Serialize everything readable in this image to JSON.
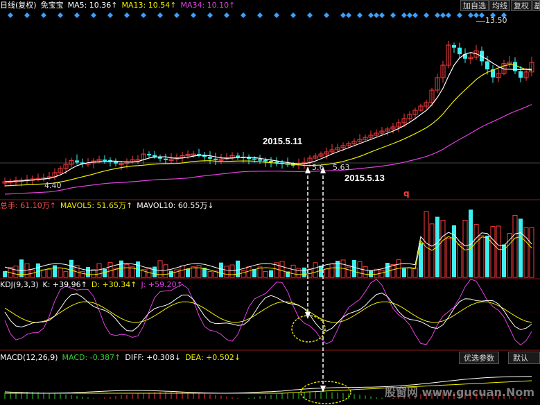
{
  "header": {
    "period": "日线(复权)",
    "stock": "免宝宝",
    "ma5": "MA5: 10.36↑",
    "ma13": "MA13: 10.54↑",
    "ma34": "MA34: 10.10↑",
    "buttons": [
      "加自选",
      "均线",
      "复权",
      "基"
    ]
  },
  "volume_header": {
    "total": "总手: 61.10万↑",
    "mavol5": "MAVOL5: 51.65万↑",
    "mavol10": "MAVOL10: 60.55万↓"
  },
  "kdj_header": {
    "name": "KDJ(9,3,3)",
    "k": "K: +39.96↑",
    "d": "D: +30.34↑",
    "j": "J: +59.20↑"
  },
  "macd_header": {
    "name": "MACD(12,26,9)",
    "macd": "MACD: -0.387↑",
    "diff": "DIFF: +0.308↓",
    "dea": "DEA: +0.502↓",
    "buttons": [
      "优选参数",
      "默认参"
    ]
  },
  "annotations": {
    "date1": "2015.5.11",
    "date2": "2015.5.13",
    "high_label": "13.50",
    "low_label": "4.40",
    "low2_label": "5.63",
    "low3_label": "5.6",
    "q": "q"
  },
  "watermark": "股窗网 www.gucuan.Nom",
  "colors": {
    "up": "#ff3c3c",
    "down": "#3cf0f0",
    "ma5": "#ffffff",
    "ma13": "#f0f000",
    "ma34": "#e040e0",
    "diamond": "#3aa0ff",
    "ellipse": "#e0e000"
  },
  "chart_data": {
    "type": "candlestick",
    "price_range": [
      4.0,
      14.5
    ],
    "high": 13.5,
    "low": 4.4,
    "annotated_dates": [
      "2015.5.11",
      "2015.5.13"
    ],
    "indicators": [
      "MA5",
      "MA13",
      "MA34",
      "VOL",
      "KDJ(9,3,3)",
      "MACD(12,26,9)"
    ]
  }
}
